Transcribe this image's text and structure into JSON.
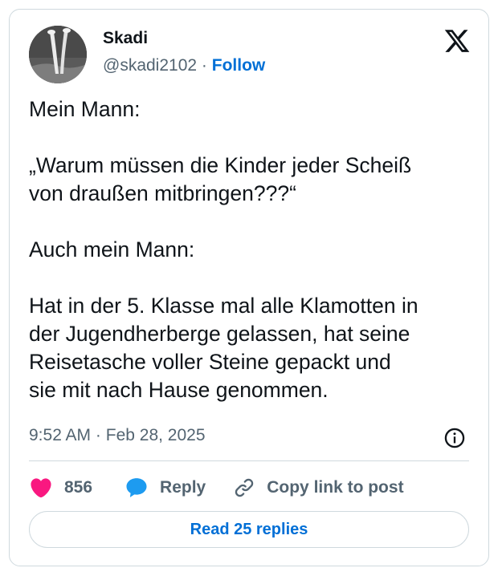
{
  "author": {
    "name": "Skadi",
    "handle": "@skadi2102",
    "separator": "·",
    "follow_label": "Follow"
  },
  "tweet": {
    "paragraphs": [
      "Mein Mann:",
      "„Warum müssen die Kinder jeder Scheiß\nvon draußen mitbringen???“",
      "Auch mein Mann:",
      "Hat in der 5. Klasse mal alle Klamotten in\nder Jugendherberge gelassen, hat seine\nReisetasche voller Steine gepackt und\nsie mit nach Hause genommen."
    ],
    "time": "9:52 AM",
    "date_separator": "·",
    "date": "Feb 28, 2025"
  },
  "actions": {
    "like_count": "856",
    "reply_label": "Reply",
    "copy_link_label": "Copy link to post"
  },
  "read_replies_label": "Read 25 replies",
  "colors": {
    "accent": "#006fd6",
    "like": "#f91880",
    "reply_bubble": "#1d9bf0",
    "secondary_text": "#536471",
    "border": "#cfd9de"
  },
  "icons": {
    "logo": "x-logo-icon",
    "info": "info-icon",
    "like": "heart-icon",
    "reply": "speech-bubble-icon",
    "copy_link": "link-icon"
  }
}
